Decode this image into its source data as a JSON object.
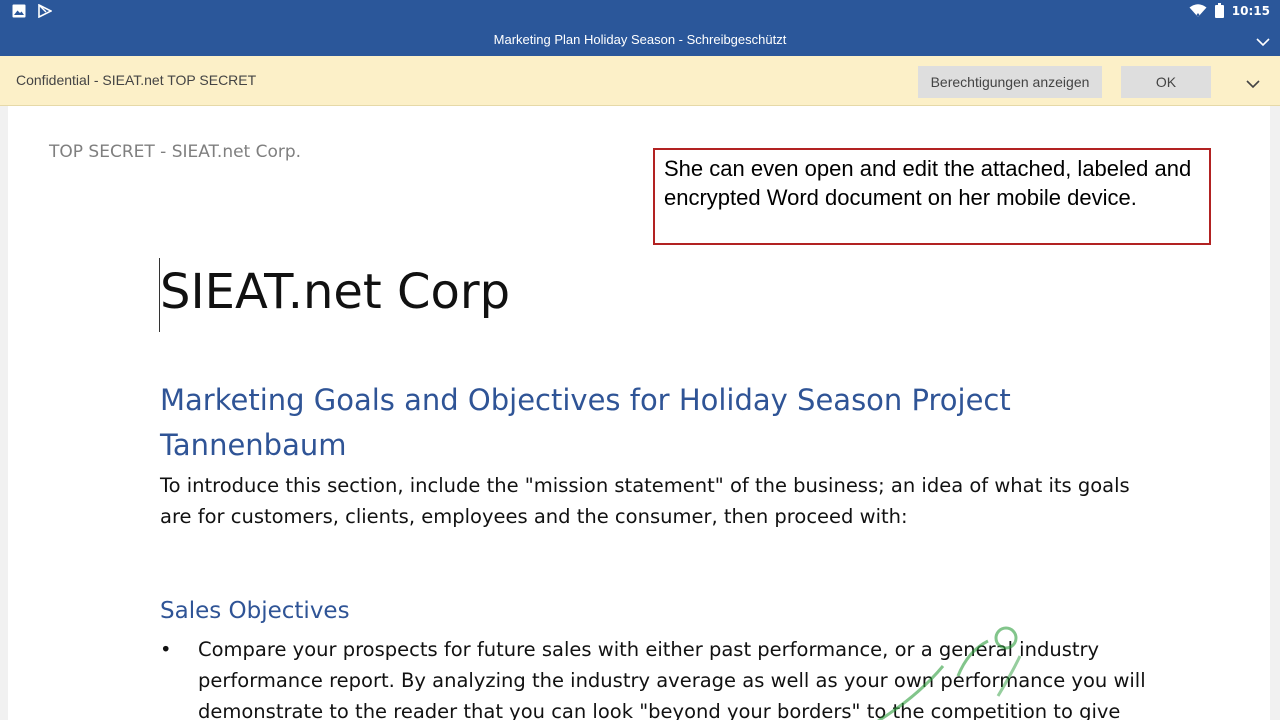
{
  "status_bar": {
    "time": "10:15",
    "left_icons": [
      "image-icon",
      "play-store-icon"
    ],
    "right_icons": [
      "wifi-icon",
      "battery-icon"
    ]
  },
  "title_bar": {
    "title": "Marketing Plan Holiday Season - Schreibgeschützt",
    "menu_icon": "chevron-down-icon"
  },
  "info_bar": {
    "label": "Confidential - SIEAT.net TOP SECRET",
    "permissions_button": "Berechtigungen anzeigen",
    "ok_button": "OK",
    "expand_icon": "chevron-down-icon"
  },
  "document": {
    "header": "TOP SECRET - SIEAT.net Corp.",
    "title": "SIEAT.net Corp",
    "heading": "Marketing Goals and Objectives for Holiday Season Project Tannenbaum",
    "intro": "To introduce this section, include the \"mission statement\" of the business; an idea of what its goals are for customers, clients, employees and the consumer, then proceed with:",
    "subheading": "Sales Objectives",
    "bullets": [
      {
        "marker": "•",
        "text": "Compare your prospects for future sales with either past performance, or a general industry performance report. By analyzing the industry average as well as your own performance you will demonstrate to the reader that you can look \"beyond your borders\" to the competition to give"
      }
    ]
  },
  "callout": {
    "text": "She can even open and edit the attached, labeled and encrypted Word document on her mobile device."
  },
  "colors": {
    "app_bar": "#2b579a",
    "info_bar": "#fcf0c8",
    "heading": "#2f5496",
    "callout_border": "#b22222",
    "watermark": "#2e9e3e"
  }
}
